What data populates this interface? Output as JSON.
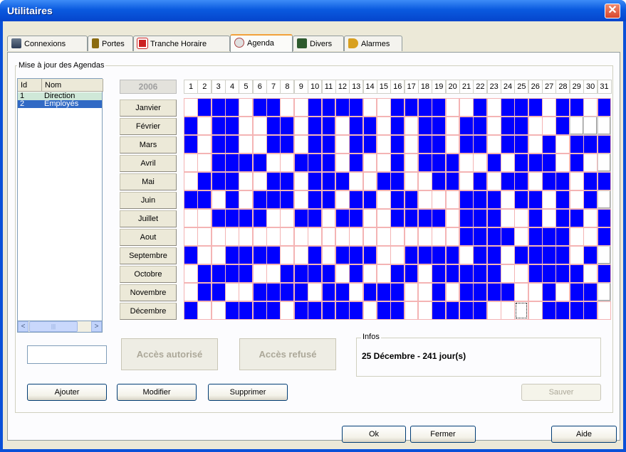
{
  "window": {
    "title": "Utilitaires",
    "close_glyph": "✕"
  },
  "tabs": [
    {
      "label": "Connexions",
      "icon": "network-icon"
    },
    {
      "label": "Portes",
      "icon": "door-icon"
    },
    {
      "label": "Tranche Horaire",
      "icon": "calendar-clock-icon"
    },
    {
      "label": "Agenda",
      "icon": "agenda-icon"
    },
    {
      "label": "Divers",
      "icon": "misc-icon"
    },
    {
      "label": "Alarmes",
      "icon": "speaker-icon"
    }
  ],
  "active_tab": "Agenda",
  "group_label": "Mise à jour des Agendas",
  "list": {
    "headers": [
      "Id",
      "Nom"
    ],
    "rows": [
      {
        "id": "1",
        "nom": "Direction"
      },
      {
        "id": "2",
        "nom": "Employés"
      }
    ],
    "selected_index": 1
  },
  "calendar": {
    "year": "2006",
    "days": [
      "1",
      "2",
      "3",
      "4",
      "5",
      "6",
      "7",
      "8",
      "9",
      "10",
      "11",
      "12",
      "13",
      "14",
      "15",
      "16",
      "17",
      "18",
      "19",
      "20",
      "21",
      "22",
      "23",
      "24",
      "25",
      "26",
      "27",
      "28",
      "29",
      "30",
      "31"
    ],
    "months": [
      "Janvier",
      "Février",
      "Mars",
      "Avril",
      "Mai",
      "Juin",
      "Juillet",
      "Aout",
      "Septembre",
      "Octobre",
      "Novembre",
      "Décembre"
    ],
    "colors": {
      "blue": "#0000ff",
      "white": "#ffffff",
      "grid": "#f4b4b4",
      "gray": "#e4e3dd"
    },
    "valid_days": [
      31,
      28,
      31,
      30,
      31,
      30,
      31,
      31,
      30,
      31,
      30,
      31
    ],
    "focused": {
      "month": 12,
      "day": 25
    },
    "pattern": [
      "0111011001111001111001011101101",
      "1011001101101101011011011001000",
      "1011001101101101011011011010111",
      "0011110011101001011100101110100",
      "0111001101110011001101011011011",
      "1101011101101101100011101101011",
      "0011110011011001111011100101101",
      "0000000000000000000011110111001",
      "1001111001011100111101101111010",
      "0111100111101001101111100111101",
      "0110011110110111001011110010110",
      "1001111011111011001111001011110"
    ]
  },
  "buttons": {
    "acces_autorise": "Accès autorisé",
    "acces_refuse": "Accès refusé",
    "ajouter": "Ajouter",
    "modifier": "Modifier",
    "supprimer": "Supprimer",
    "sauver": "Sauver",
    "ok": "Ok",
    "fermer": "Fermer",
    "aide": "Aide"
  },
  "infos": {
    "label": "Infos",
    "text": "25 Décembre - 241 jour(s)"
  },
  "scrollbar": {
    "left": "<",
    "right": ">",
    "thumb": "|||"
  }
}
